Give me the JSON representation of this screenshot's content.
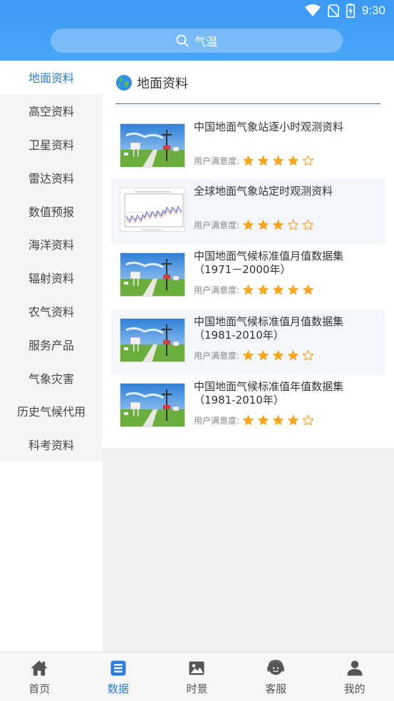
{
  "status_bar": {
    "time": "9:30"
  },
  "search": {
    "placeholder": "气温"
  },
  "sidebar": {
    "items": [
      {
        "label": "地面资料",
        "active": true
      },
      {
        "label": "高空资料"
      },
      {
        "label": "卫星资料"
      },
      {
        "label": "雷达资料"
      },
      {
        "label": "数值预报"
      },
      {
        "label": "海洋资料"
      },
      {
        "label": "辐射资料"
      },
      {
        "label": "农气资料"
      },
      {
        "label": "服务产品"
      },
      {
        "label": "气象灾害"
      },
      {
        "label": "历史气候代用"
      },
      {
        "label": "科考资料"
      }
    ]
  },
  "content": {
    "title": "地面资料",
    "title_icon": "globe-icon",
    "rating_label": "用户满意度:",
    "cards": [
      {
        "title": "中国地面气象站逐小时观测资料",
        "rating": 4,
        "thumb": "weather-station-photo"
      },
      {
        "title": "全球地面气象站定时观测资料",
        "rating": 3,
        "thumb": "temperature-chart"
      },
      {
        "title": "中国地面气候标准值月值数据集（1971－2000年）",
        "rating": 5,
        "thumb": "weather-station-photo"
      },
      {
        "title": "中国地面气候标准值月值数据集（1981-2010年）",
        "rating": 4,
        "thumb": "weather-station-photo"
      },
      {
        "title": "中国地面气候标准值年值数据集（1981-2010年）",
        "rating": 4,
        "thumb": "weather-station-photo"
      }
    ]
  },
  "bottom_nav": {
    "items": [
      {
        "label": "首页",
        "icon": "home-icon"
      },
      {
        "label": "数据",
        "icon": "data-icon",
        "active": true
      },
      {
        "label": "时景",
        "icon": "image-icon"
      },
      {
        "label": "客服",
        "icon": "support-icon"
      },
      {
        "label": "我的",
        "icon": "user-icon"
      }
    ]
  },
  "colors": {
    "accent": "#2a7de1",
    "header": "#3a99f2",
    "star": "#f5a623"
  }
}
